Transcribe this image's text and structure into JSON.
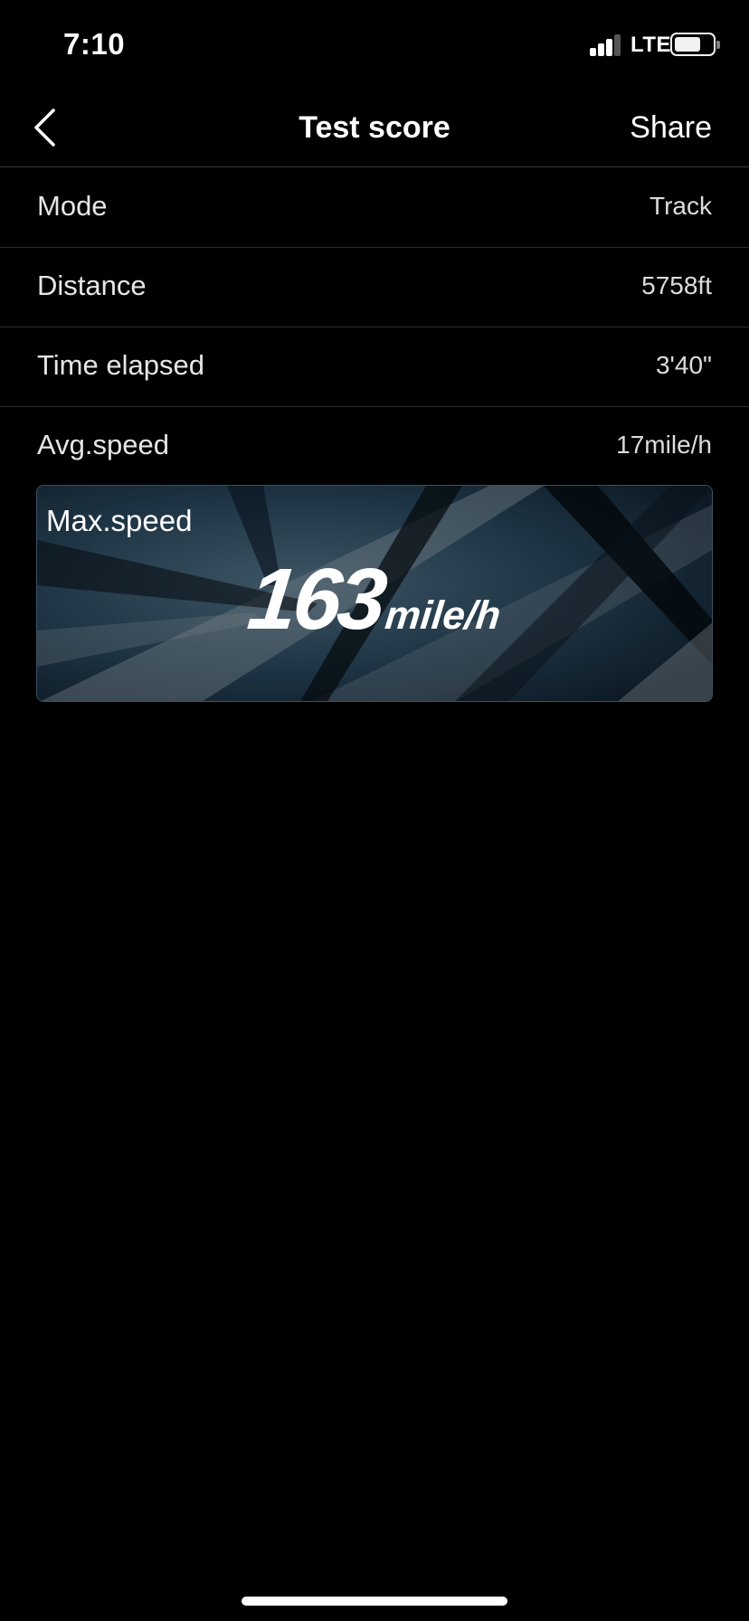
{
  "status_bar": {
    "time": "7:10",
    "network": "LTE",
    "signal_bars_filled": 3,
    "signal_bars_total": 4,
    "battery_level": 0.7
  },
  "nav": {
    "title": "Test score",
    "share_label": "Share",
    "back_icon": "chevron-left-icon"
  },
  "rows": [
    {
      "label": "Mode",
      "value": "Track"
    },
    {
      "label": "Distance",
      "value": "5758ft"
    },
    {
      "label": "Time elapsed",
      "value": "3'40\""
    },
    {
      "label": "Avg.speed",
      "value": "17mile/h"
    }
  ],
  "max_speed": {
    "label": "Max.speed",
    "value": "163",
    "unit": "mile/h"
  },
  "colors": {
    "background": "#000000",
    "card_background": "#0e1c27",
    "card_border": "#3c5263",
    "separator": "#2c2c2e"
  }
}
